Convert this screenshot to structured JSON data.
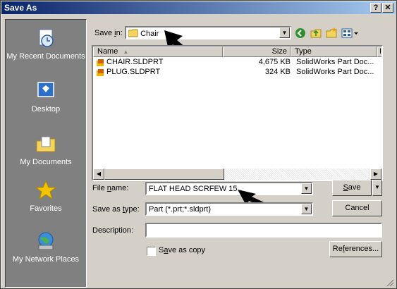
{
  "dialog": {
    "title": "Save As",
    "help_label": "?",
    "close_label": "✕"
  },
  "places": [
    {
      "label": "My Recent Documents",
      "icon": "recent-documents-icon"
    },
    {
      "label": "Desktop",
      "icon": "desktop-icon"
    },
    {
      "label": "My Documents",
      "icon": "my-documents-icon"
    },
    {
      "label": "Favorites",
      "icon": "favorites-icon"
    },
    {
      "label": "My Network Places",
      "icon": "network-places-icon"
    }
  ],
  "save_in": {
    "label_pre": "Save ",
    "label_u": "i",
    "label_post": "n:",
    "value": "Chair"
  },
  "list": {
    "headers": {
      "name": "Name",
      "size": "Size",
      "type": "Type",
      "extra": "I"
    },
    "files": [
      {
        "name": "CHAIR.SLDPRT",
        "size": "4,675 KB",
        "type": "SolidWorks Part Doc...",
        "extra": ":"
      },
      {
        "name": "PLUG.SLDPRT",
        "size": "324 KB",
        "type": "SolidWorks Part Doc...",
        "extra": ":"
      }
    ]
  },
  "file_name": {
    "label_pre": "File ",
    "label_u": "n",
    "label_post": "ame:",
    "value": "FLAT HEAD SCRFEW 15"
  },
  "save_as_type": {
    "label_pre": "Save as ",
    "label_u": "t",
    "label_post": "ype:",
    "value": "Part (*.prt;*.sldprt)"
  },
  "description": {
    "label": "Description:",
    "value": ""
  },
  "save_copy": {
    "label_pre": "S",
    "label_u": "a",
    "label_post": "ve as copy",
    "checked": false
  },
  "buttons": {
    "save_u": "S",
    "save_post": "ave",
    "split_arrow": "▼",
    "cancel": "Cancel",
    "references_pre": "Re",
    "references_u": "f",
    "references_post": "erences..."
  },
  "colors": {
    "title_start": "#0a246a",
    "title_end": "#a6caf0",
    "places_bg": "#808080",
    "face": "#d4d0c8"
  }
}
